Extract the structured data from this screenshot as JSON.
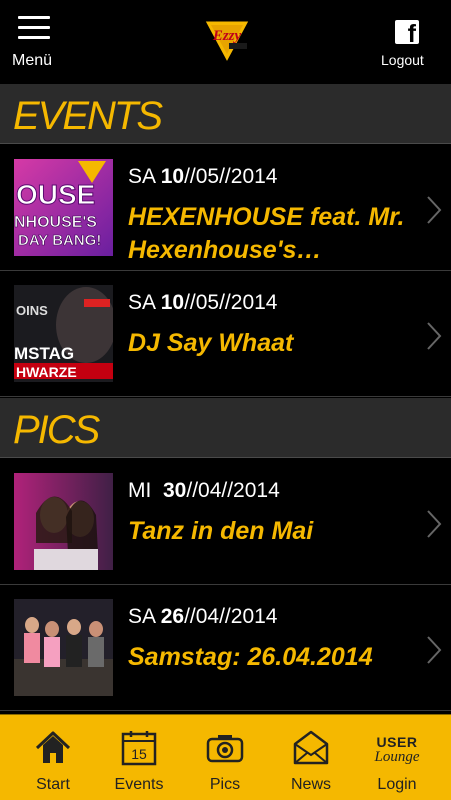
{
  "header": {
    "menu_label": "Menü",
    "logout_label": "Logout",
    "logo_text": "Ezzy"
  },
  "sections": {
    "events_title": "EVENTS",
    "pics_title": "PICS"
  },
  "events": [
    {
      "weekday": "SA",
      "day": "10",
      "rest": "//05//2014",
      "title": "HEXENHOUSE feat. Mr. Hexenhouse's…",
      "thumb_text_top": "OUSE",
      "thumb_text_mid": "NHOUSE'S",
      "thumb_text_bot": "DAY BANG!"
    },
    {
      "weekday": "SA",
      "day": "10",
      "rest": "//05//2014",
      "title": "DJ Say Whaat",
      "thumb_text_top": "OINS",
      "thumb_text_mid": "MSTAG",
      "thumb_text_bot": "HWARZE"
    }
  ],
  "pics": [
    {
      "weekday": "MI",
      "day": "30",
      "rest": "//04//2014",
      "title": "Tanz in den Mai"
    },
    {
      "weekday": "SA",
      "day": "26",
      "rest": "//04//2014",
      "title": "Samstag: 26.04.2014"
    }
  ],
  "tabbar": {
    "start": "Start",
    "events": "Events",
    "events_calendar_day": "15",
    "pics": "Pics",
    "news": "News",
    "login": "Login",
    "user_lounge_top": "USER",
    "user_lounge_bottom": "Lounge"
  },
  "colors": {
    "accent": "#f5b800",
    "section_bg": "#2b2b2b",
    "background": "#000000"
  }
}
